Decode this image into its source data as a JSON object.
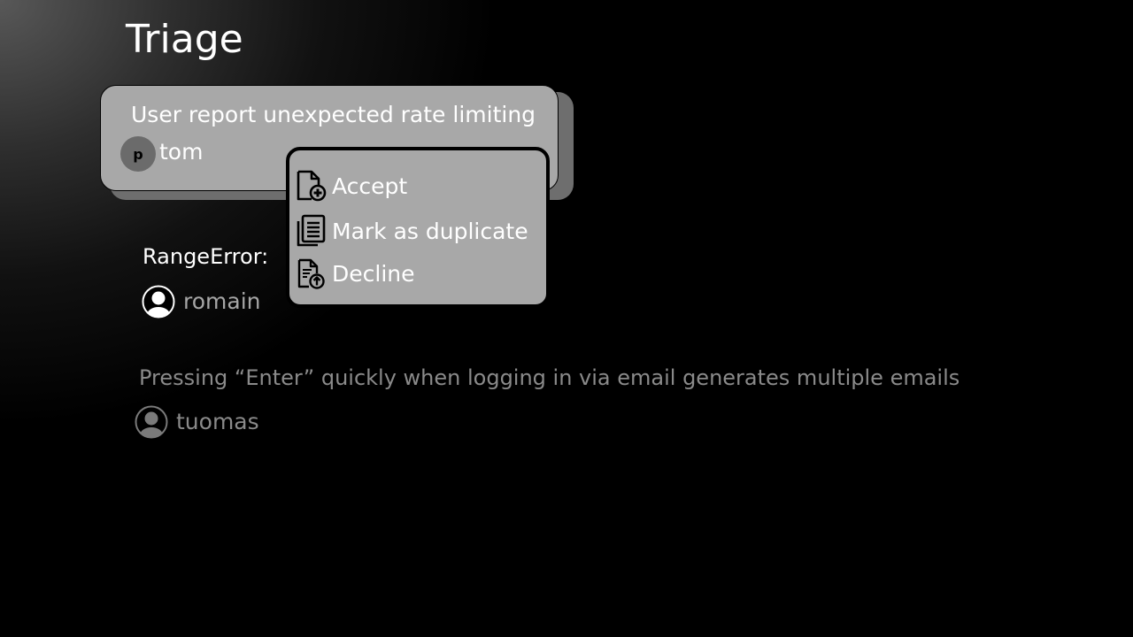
{
  "page": {
    "title": "Triage"
  },
  "selected_issue": {
    "title": "User report unexpected rate limiting",
    "avatar_letter": "p",
    "user": "tom"
  },
  "context_menu": {
    "items": [
      {
        "label": "Accept",
        "icon": "file-add-icon"
      },
      {
        "label": "Mark as duplicate",
        "icon": "document-stack-icon"
      },
      {
        "label": "Decline",
        "icon": "file-upload-icon"
      }
    ]
  },
  "issues": [
    {
      "title": "RangeError:",
      "user": "romain",
      "avatar": "user-circle-icon"
    },
    {
      "title": "Pressing “Enter” quickly when logging in via email generates multiple emails",
      "user": "tuomas",
      "avatar": "user-circle-icon"
    }
  ],
  "colors": {
    "card_bg": "#a8a8a8",
    "menu_bg": "#a8a8a8",
    "muted_text": "#8a8a8a",
    "background": "#000000"
  }
}
